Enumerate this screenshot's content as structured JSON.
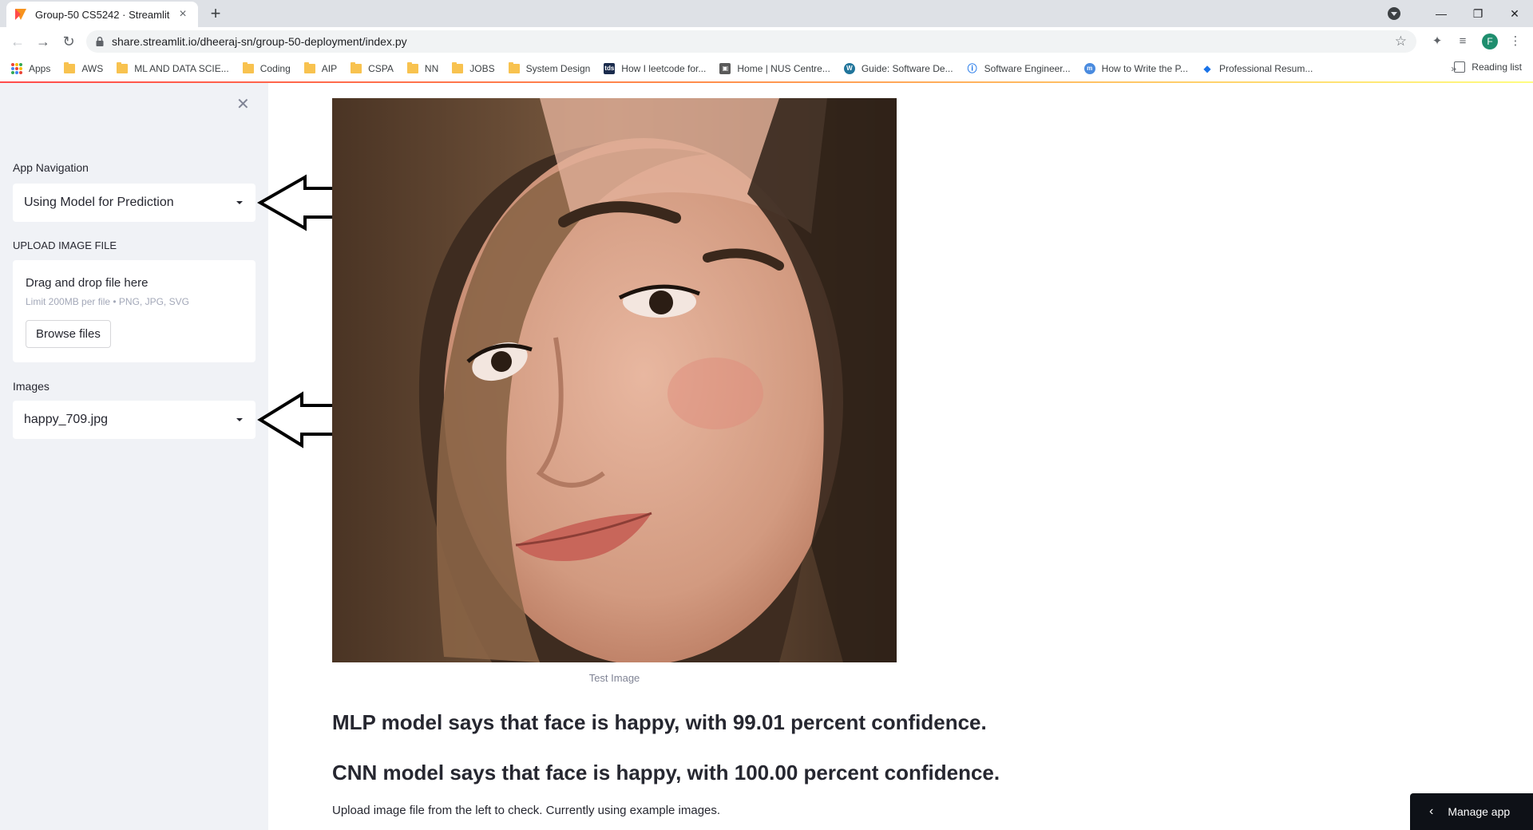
{
  "browser": {
    "tab_title": "Group-50 CS5242 · Streamlit",
    "new_tab": "+",
    "url": "share.streamlit.io/dheeraj-sn/group-50-deployment/index.py",
    "avatar_letter": "F",
    "bookmarks": [
      "Apps",
      "AWS",
      "ML AND DATA SCIE...",
      "Coding",
      "AIP",
      "CSPA",
      "NN",
      "JOBS",
      "System Design",
      "How I leetcode for...",
      "Home | NUS Centre...",
      "Guide: Software De...",
      "Software Engineer...",
      "How to Write the P...",
      "Professional Resum..."
    ],
    "bookmarks_more": "»",
    "reading_list": "Reading list"
  },
  "sidebar": {
    "close": "✕",
    "nav_label": "App Navigation",
    "nav_value": "Using Model for Prediction",
    "upload_label": "UPLOAD IMAGE FILE",
    "upload_title": "Drag and drop file here",
    "upload_limit": "Limit 200MB per file • PNG, JPG, SVG",
    "browse_label": "Browse files",
    "images_label": "Images",
    "images_value": "happy_709.jpg"
  },
  "main": {
    "image_caption": "Test Image",
    "mlp_result": "MLP model says that face is happy, with 99.01 percent confidence.",
    "cnn_result": "CNN model says that face is happy, with 100.00 percent confidence.",
    "footer": "Upload image file from the left to check. Currently using example images."
  },
  "manage_app": "Manage app",
  "colors": {
    "sidebar_bg": "#f0f2f6",
    "streamlit_red": "#ff4b4b",
    "manage_bg": "#0e1117"
  }
}
